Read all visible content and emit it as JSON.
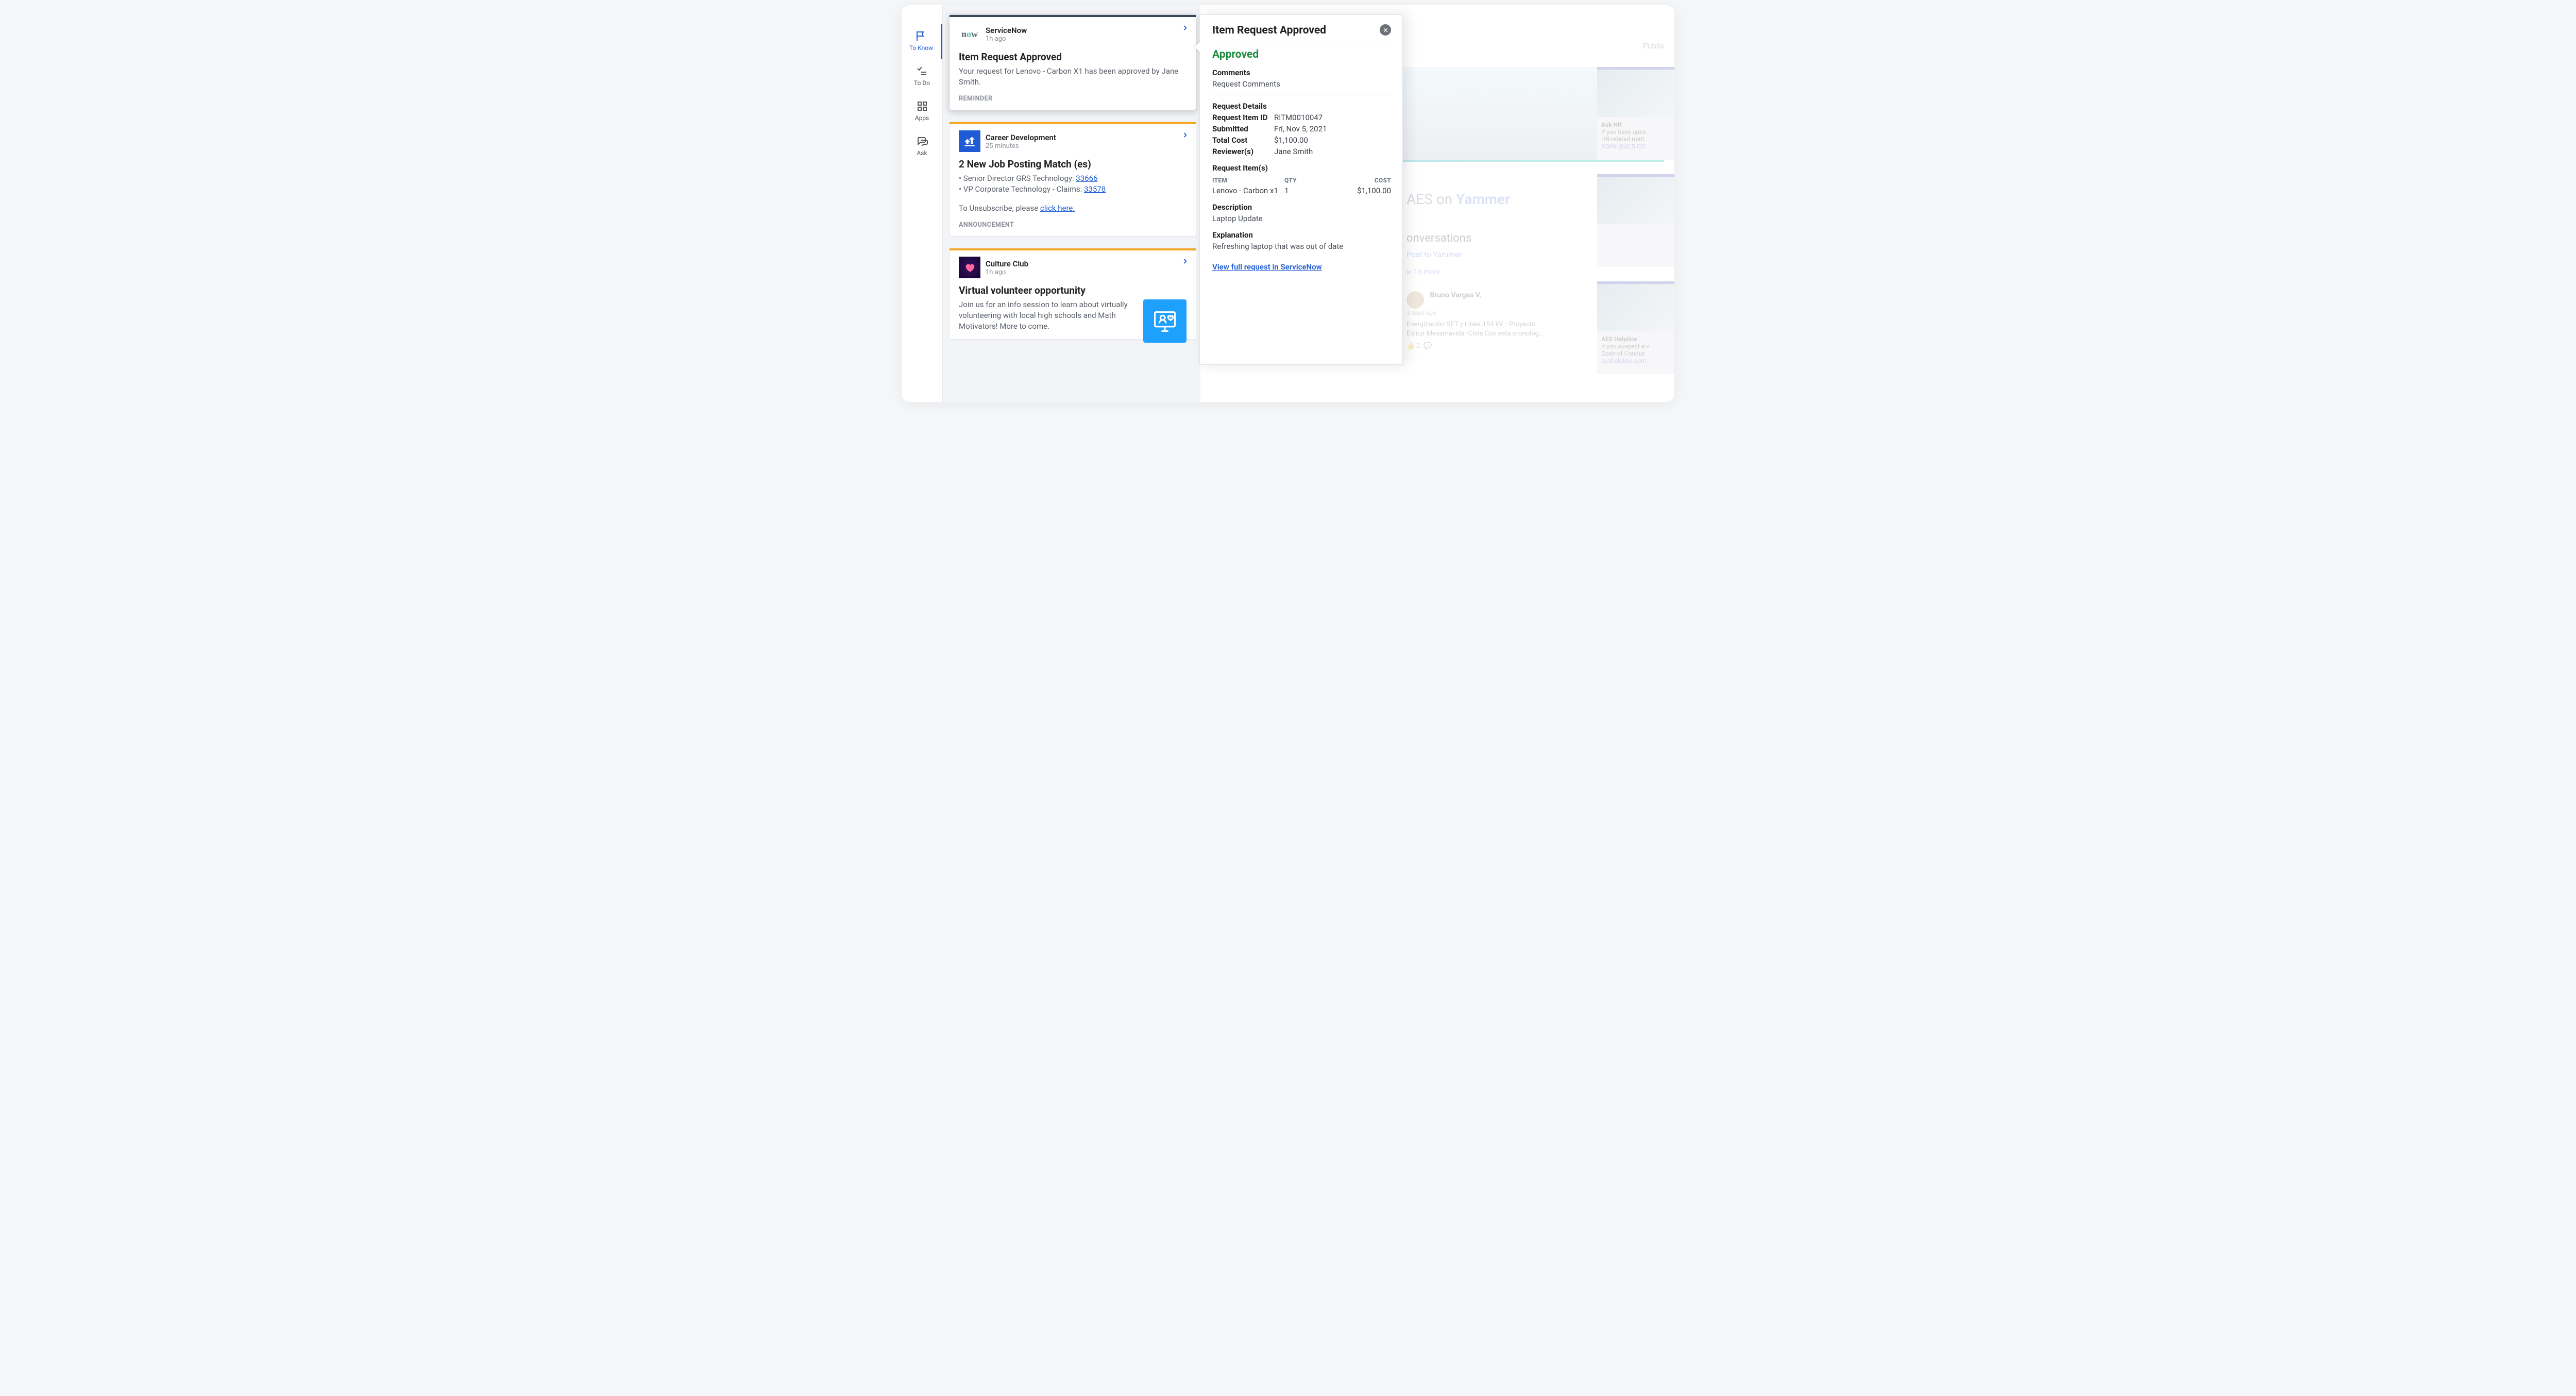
{
  "nav": {
    "toKnow": "To Know",
    "toDo": "To Do",
    "apps": "Apps",
    "ask": "Ask"
  },
  "feed": [
    {
      "source": "ServiceNow",
      "time": "1h ago",
      "title": "Item Request Approved",
      "body": "Your request for Lenovo - Carbon X1 has been approved by Jane Smith.",
      "footer": "REMINDER"
    },
    {
      "source": "Career Development",
      "time": "25 minutes",
      "title": "2 New Job Posting Match (es)",
      "items": [
        {
          "label": "• Senior Director GRS Technology: ",
          "link": "33666"
        },
        {
          "label": "• VP Corporate Technology - Claims: ",
          "link": "33578"
        }
      ],
      "unsubscribe_prefix": "To Unsubscribe, please ",
      "unsubscribe_link": "click here.",
      "footer": "ANNOUNCEMENT"
    },
    {
      "source": "Culture Club",
      "time": "1h ago",
      "title": "Virtual volunteer opportunity",
      "body": "Join us for an info session to learn about virtually volunteering with local high schools and Math Motivators! More to come."
    }
  ],
  "detail": {
    "title": "Item Request Approved",
    "status": "Approved",
    "comments_label": "Comments",
    "comments_value": "Request Comments",
    "request_details_label": "Request Details",
    "fields": {
      "request_item_id_label": "Request Item ID",
      "request_item_id_value": "RITM0010047",
      "submitted_label": "Submitted",
      "submitted_value": "Fri, Nov 5, 2021",
      "total_cost_label": "Total Cost",
      "total_cost_value": "$1,100.00",
      "reviewers_label": "Reviewer(s)",
      "reviewers_value": "Jane Smith"
    },
    "items_label": "Request Item(s)",
    "items_cols": {
      "c1": "ITEM",
      "c2": "QTY",
      "c3": "COST"
    },
    "items": [
      {
        "name": "Lenovo - Carbon x1",
        "qty": "1",
        "cost": "$1,100.00"
      }
    ],
    "description_label": "Description",
    "description_value": "Laptop Update",
    "explanation_label": "Explanation",
    "explanation_value": "Refreshing laptop that was out of date",
    "full_link": "View full request in ServiceNow"
  },
  "background": {
    "publish": "Publis",
    "yammer_prefix": "AES on ",
    "yammer_brand": "Yammer",
    "conversations": "onversations",
    "post_link": "Post to Yammer",
    "view_more": "w 15 more",
    "post": {
      "name": "Bruno Vargas V.",
      "time": "3 days ago",
      "body": "Energización SET y Línea 154 kV –Proyecto Eólico Mesamavida -Chile Con esta cronolog…",
      "like_count": "2"
    },
    "side_cards": [
      {
        "title": "Ask HR",
        "line1": "If you have ques",
        "line2": "HR-related matt",
        "link": "ASKhr@AES.CO"
      },
      {
        "title": "",
        "line1": "",
        "line2": "",
        "link": ""
      },
      {
        "title": "AES Helpline",
        "line1": "If you suspect a v",
        "line2": "Code of Conduc",
        "link": "aeshelpline.com"
      }
    ]
  },
  "colors": {
    "primary": "#1f5bd6",
    "approved": "#1e8a3e",
    "orangeStripe": "#f5a623",
    "darkStripe": "#3b4a5a"
  }
}
